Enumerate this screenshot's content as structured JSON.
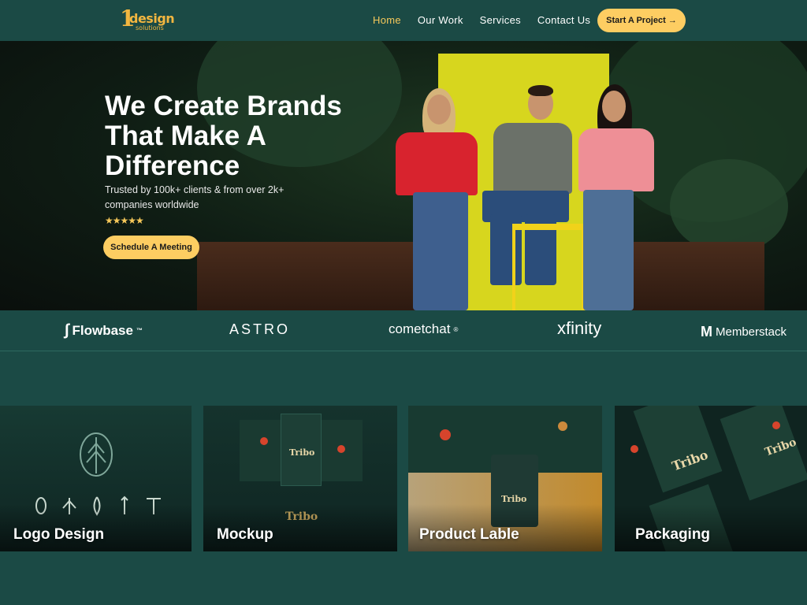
{
  "brand": {
    "logo_text": "design",
    "logo_sub": "solutions",
    "accent": "#fdcd62",
    "bg": "#1b4a45"
  },
  "nav": {
    "items": [
      "Home",
      "Our Work",
      "Services",
      "Contact Us"
    ],
    "active": "Home"
  },
  "cta": {
    "label": "Start A Project →"
  },
  "hero": {
    "title": "We Create Brands That Make A Difference",
    "subtitle": "Trusted by 100k+ clients & from over 2k+ companies worldwide",
    "rating": "★★★★★",
    "button": "Schedule A Meeting"
  },
  "clients": [
    "Flowbase",
    "ASTRO",
    "cometchat",
    "xfinity",
    "Memberstack"
  ],
  "portfolio": [
    {
      "label": "Logo Design",
      "icon_labels": [
        "GRÃO",
        "PÉ DE CAFÉ",
        "PENA",
        "FLECHA",
        "LETRA \"T\""
      ]
    },
    {
      "label": "Mockup",
      "brand_text": "Tribo"
    },
    {
      "label": "Product Lable",
      "brand_text": "Tribo"
    },
    {
      "label": "Packaging",
      "brand_text": "Tribo"
    }
  ]
}
